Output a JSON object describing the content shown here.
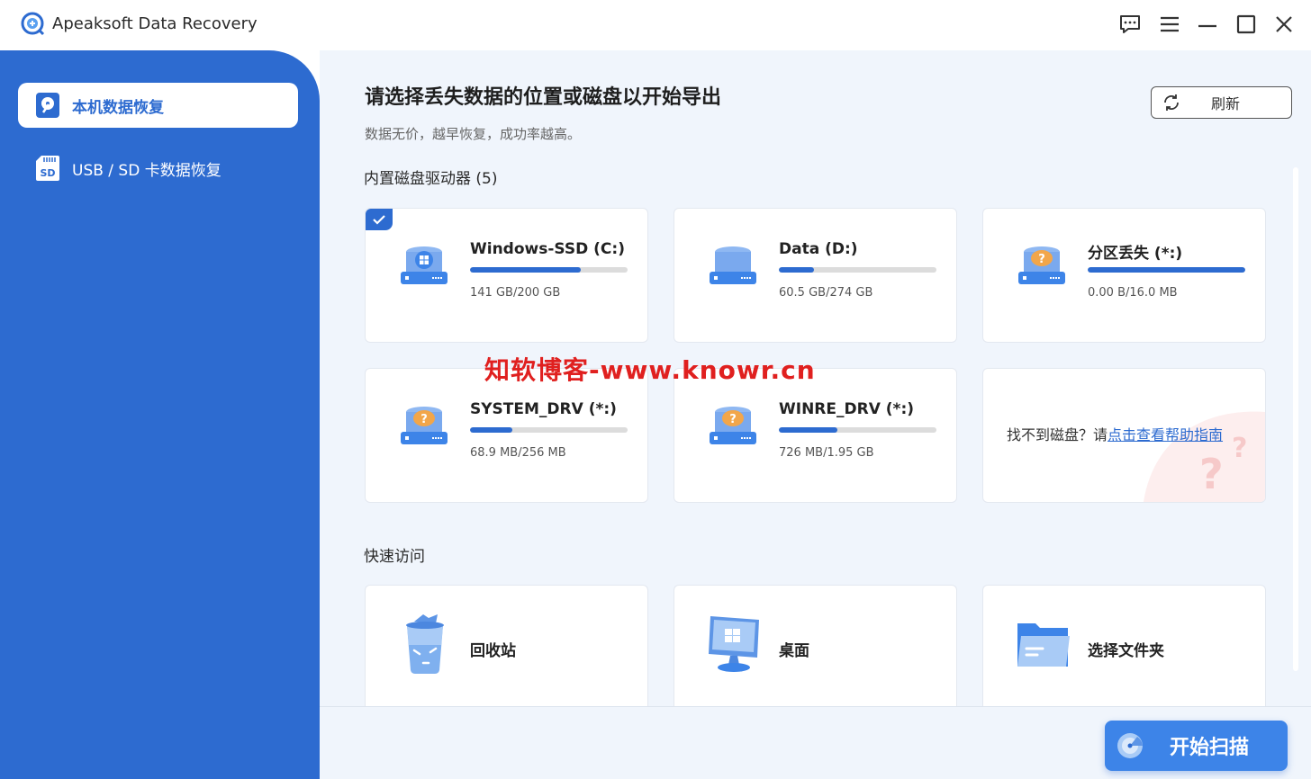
{
  "app": {
    "title": "Apeaksoft Data Recovery",
    "accent": "#2d6bd0"
  },
  "window_controls": [
    {
      "name": "feedback-icon"
    },
    {
      "name": "menu-icon"
    },
    {
      "name": "minimize-icon"
    },
    {
      "name": "maximize-icon"
    },
    {
      "name": "close-icon"
    }
  ],
  "sidebar": {
    "items": [
      {
        "label": "本机数据恢复",
        "icon": "hard-drive-icon",
        "active": true
      },
      {
        "label": "USB / SD 卡数据恢复",
        "icon": "sd-card-icon",
        "active": false
      }
    ]
  },
  "main": {
    "title": "请选择丢失数据的位置或磁盘以开始导出",
    "subtitle": "数据无价，越早恢复，成功率越高。",
    "refresh_label": "刷新",
    "drives_section": "内置磁盘驱动器 (5)",
    "drives": [
      {
        "name": "Windows-SSD (C:)",
        "size": "141 GB/200 GB",
        "used_fraction": 0.705,
        "icon": "windows-disk-icon",
        "selected": true
      },
      {
        "name": "Data (D:)",
        "size": "60.5 GB/274 GB",
        "used_fraction": 0.22,
        "icon": "disk-icon",
        "selected": false
      },
      {
        "name": "分区丢失 (*:)",
        "size": "0.00  B/16.0 MB",
        "used_fraction": 1.0,
        "icon": "unknown-disk-icon",
        "selected": false
      },
      {
        "name": "SYSTEM_DRV (*:)",
        "size": "68.9 MB/256 MB",
        "used_fraction": 0.27,
        "icon": "unknown-disk-icon",
        "selected": false
      },
      {
        "name": "WINRE_DRV (*:)",
        "size": "726 MB/1.95 GB",
        "used_fraction": 0.37,
        "icon": "unknown-disk-icon",
        "selected": false
      }
    ],
    "help": {
      "prefix": "找不到磁盘？请",
      "link": "点击查看帮助指南"
    },
    "quick_section": "快速访问",
    "quick_access": [
      {
        "label": "回收站",
        "icon": "recycle-bin-icon"
      },
      {
        "label": "桌面",
        "icon": "desktop-monitor-icon"
      },
      {
        "label": "选择文件夹",
        "icon": "folder-icon"
      }
    ],
    "scan_label": "开始扫描"
  },
  "watermark": "知软博客-www.knowr.cn"
}
